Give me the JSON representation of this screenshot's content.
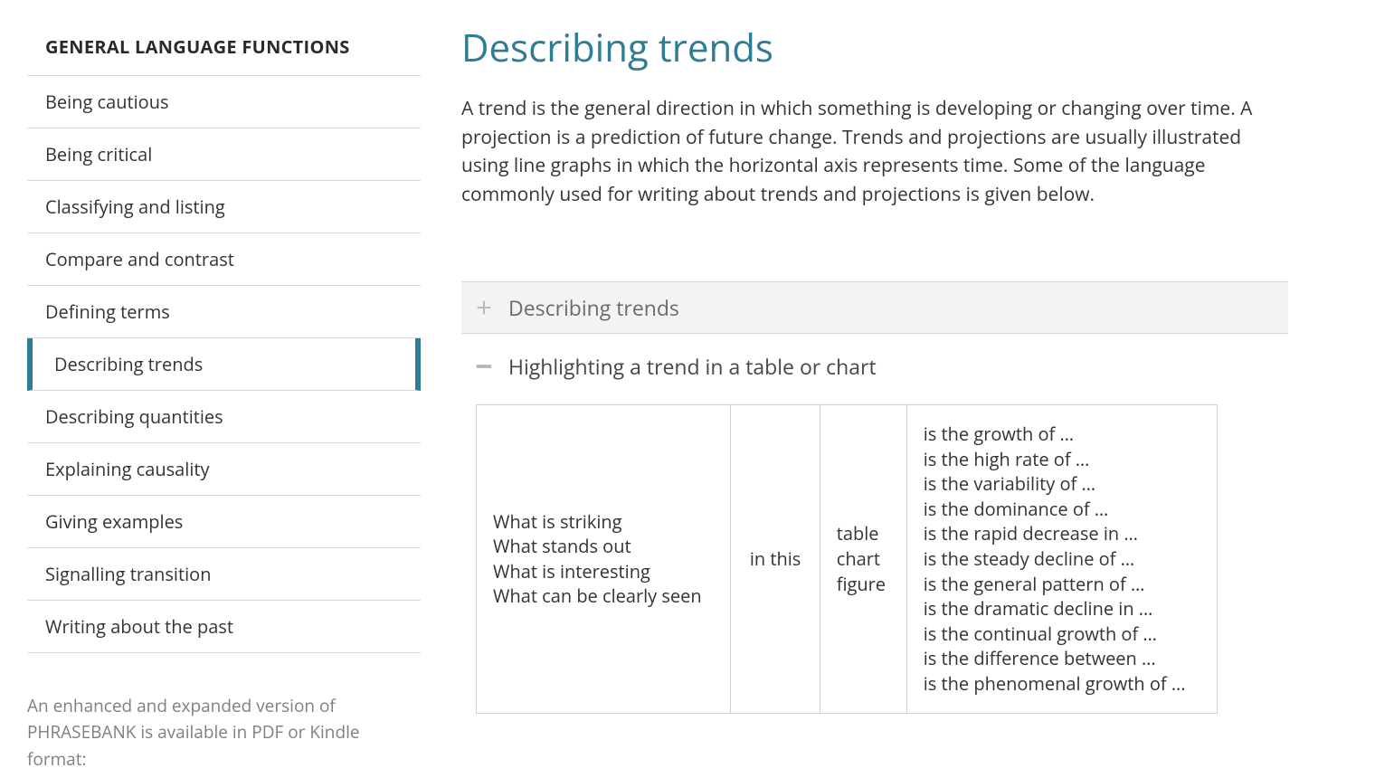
{
  "sidebar": {
    "heading": "GENERAL LANGUAGE FUNCTIONS",
    "items": [
      {
        "label": "Being cautious"
      },
      {
        "label": "Being critical"
      },
      {
        "label": "Classifying and listing"
      },
      {
        "label": "Compare and contrast"
      },
      {
        "label": "Defining terms"
      },
      {
        "label": "Describing trends",
        "active": true
      },
      {
        "label": "Describing quantities"
      },
      {
        "label": "Explaining causality"
      },
      {
        "label": "Giving examples"
      },
      {
        "label": "Signalling transition"
      },
      {
        "label": "Writing about the past"
      }
    ],
    "note": "An enhanced and expanded version of PHRASEBANK is available in PDF or Kindle format:"
  },
  "main": {
    "title": "Describing trends",
    "intro": "A trend is the general direction in which something is developing or changing over time. A projection is a prediction of future change. Trends and projections are usually illustrated using line graphs in which the horizontal axis represents time. Some of the language commonly used for writing about trends and projections is given below."
  },
  "accordions": {
    "closed_title": "Describing trends",
    "open_title": "Highlighting a trend in a table or chart"
  },
  "table": {
    "col1": [
      "What is striking",
      "What stands out",
      "What is interesting",
      "What can be clearly seen"
    ],
    "col2": "in this",
    "col3": [
      "table",
      "chart",
      "figure"
    ],
    "col4": [
      "is the growth of …",
      "is the high rate of …",
      "is the variability of …",
      "is the dominance of …",
      "is the rapid decrease in …",
      "is the steady decline of …",
      "is the general pattern of …",
      "is the dramatic decline in …",
      "is the continual growth of …",
      "is the difference between …",
      "is the phenomenal growth of …"
    ]
  }
}
